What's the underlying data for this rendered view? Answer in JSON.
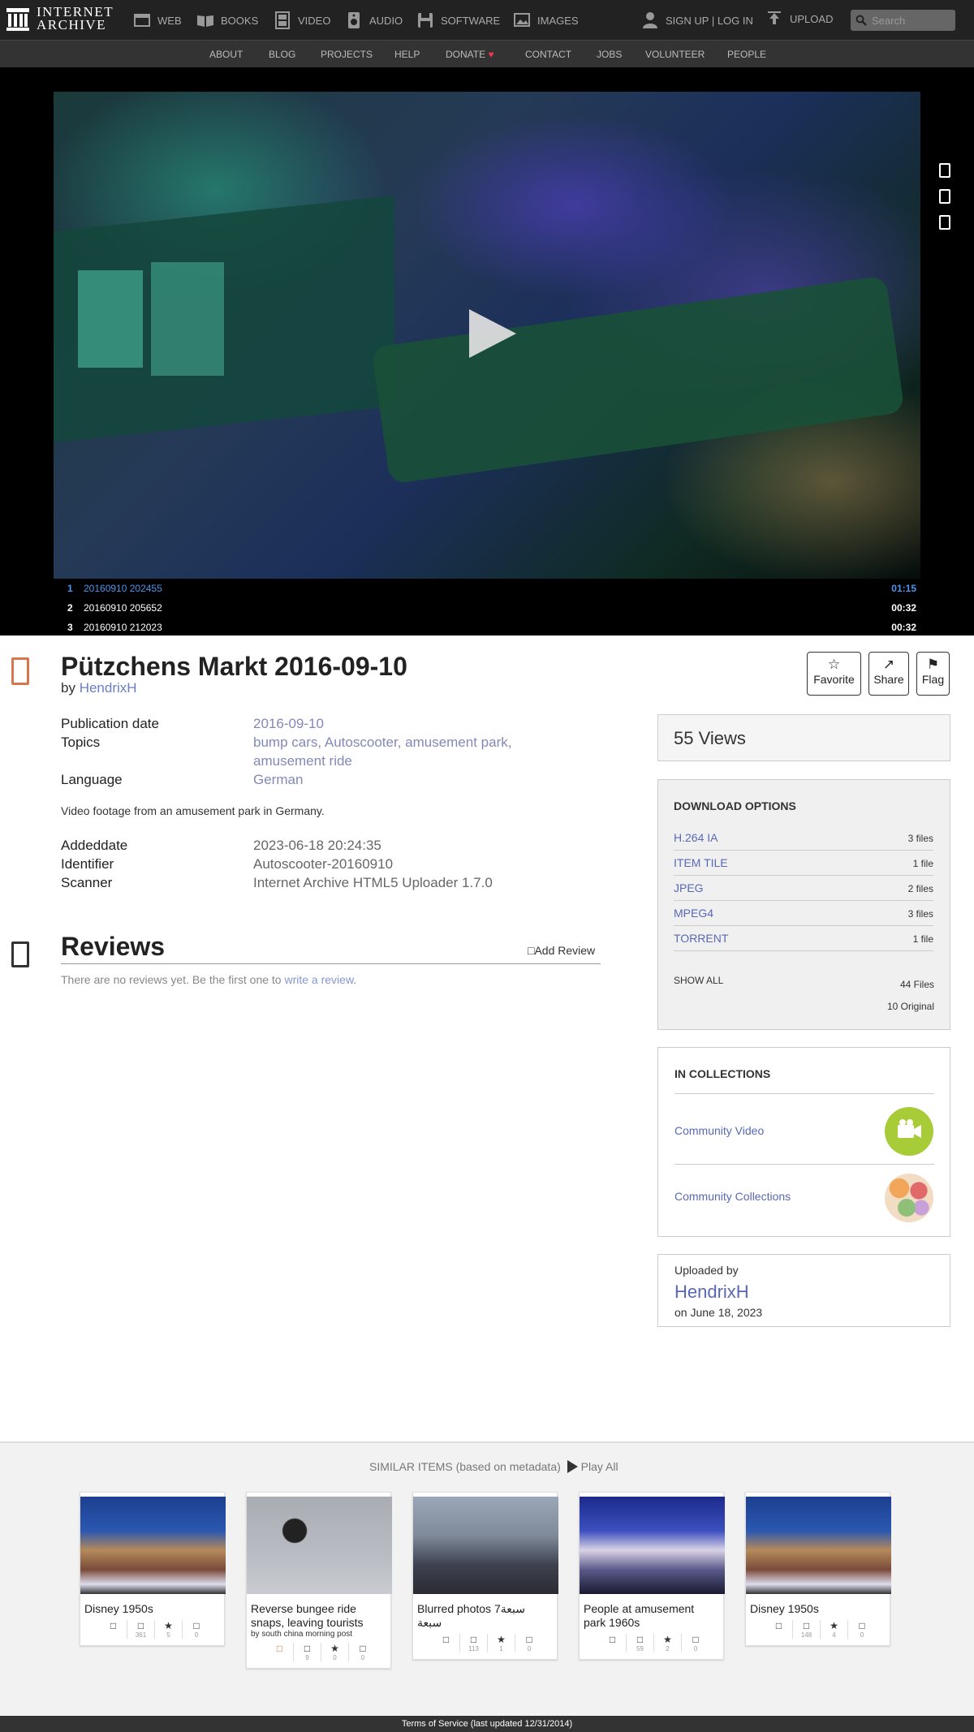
{
  "topbar": {
    "logo_line1": "INTERNET",
    "logo_line2": "ARCHIVE",
    "nav": [
      {
        "label": "WEB"
      },
      {
        "label": "BOOKS"
      },
      {
        "label": "VIDEO"
      },
      {
        "label": "AUDIO"
      },
      {
        "label": "SOFTWARE"
      },
      {
        "label": "IMAGES"
      }
    ],
    "signup": "SIGN UP | LOG IN",
    "upload": "UPLOAD",
    "search_placeholder": "Search"
  },
  "subnav": [
    "ABOUT",
    "BLOG",
    "PROJECTS",
    "HELP",
    "DONATE",
    "CONTACT",
    "JOBS",
    "VOLUNTEER",
    "PEOPLE"
  ],
  "playlist": [
    {
      "num": "1",
      "title": "20160910 202455",
      "duration": "01:15"
    },
    {
      "num": "2",
      "title": "20160910 205652",
      "duration": "00:32"
    },
    {
      "num": "3",
      "title": "20160910 212023",
      "duration": "00:32"
    }
  ],
  "item": {
    "title": "Pützchens Markt 2016-09-10",
    "by_label": "by",
    "author": "HendrixH",
    "actions": {
      "favorite": "Favorite",
      "share": "Share",
      "flag": "Flag"
    },
    "meta": {
      "pubdate_label": "Publication date",
      "pubdate": "2016-09-10",
      "topics_label": "Topics",
      "topics": [
        "bump cars",
        "Autoscooter",
        "amusement park",
        "amusement ride"
      ],
      "language_label": "Language",
      "language": "German"
    },
    "description": "Video footage from an amusement park in Germany.",
    "meta2": {
      "addeddate_label": "Addeddate",
      "addeddate": "2023-06-18 20:24:35",
      "identifier_label": "Identifier",
      "identifier": "Autoscooter-20160910",
      "scanner_label": "Scanner",
      "scanner": "Internet Archive HTML5 Uploader 1.7.0"
    }
  },
  "reviews": {
    "title": "Reviews",
    "add": "Add Review",
    "empty_prefix": "There are no reviews yet. Be the first one to",
    "empty_link": "write a review",
    "empty_suffix": "."
  },
  "sidebar": {
    "views": "55 Views",
    "download_title": "DOWNLOAD OPTIONS",
    "formats": [
      {
        "name": "H.264 IA",
        "count": "3 files"
      },
      {
        "name": "ITEM TILE",
        "count": "1 file"
      },
      {
        "name": "JPEG",
        "count": "2 files"
      },
      {
        "name": "MPEG4",
        "count": "3 files"
      },
      {
        "name": "TORRENT",
        "count": "1 file"
      }
    ],
    "show_all": "SHOW ALL",
    "total_files": "44 Files",
    "original_files": "10 Original",
    "collections_title": "IN COLLECTIONS",
    "collections": [
      {
        "name": "Community Video"
      },
      {
        "name": "Community Collections"
      }
    ],
    "uploaded_by_label": "Uploaded by",
    "uploader": "HendrixH",
    "upload_date": "on June 18, 2023"
  },
  "similar": {
    "heading": "SIMILAR ITEMS (based on metadata)",
    "play_all": "Play All",
    "items": [
      {
        "title": "Disney 1950s",
        "by": "",
        "views": "361",
        "favs": "5",
        "reviews": "0"
      },
      {
        "title": "Reverse bungee ride snaps, leaving tourists",
        "by": "by south china morning post",
        "views": "9",
        "favs": "0",
        "reviews": "0"
      },
      {
        "title": "Blurred photos 7سبعة سبعة",
        "by": "",
        "views": "113",
        "favs": "1",
        "reviews": "0"
      },
      {
        "title": "People at amusement park 1960s",
        "by": "",
        "views": "59",
        "favs": "2",
        "reviews": "0"
      },
      {
        "title": "Disney 1950s",
        "by": "",
        "views": "148",
        "favs": "4",
        "reviews": "0"
      }
    ]
  },
  "footer": "Terms of Service (last updated 12/31/2014)",
  "colors": {
    "accent_link": "#5968b5",
    "donate_heart": "#e8384f",
    "media_icon": "#d9764f",
    "playlist_active": "#4b95ec"
  }
}
